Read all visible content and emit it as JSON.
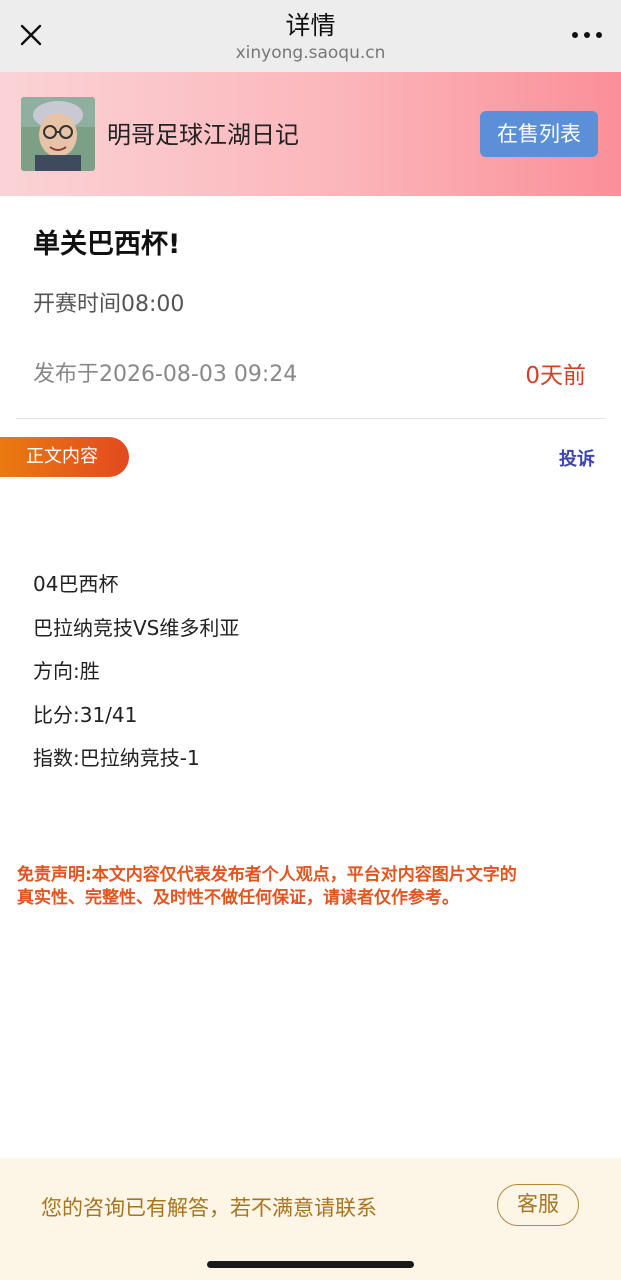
{
  "nav": {
    "title": "详情",
    "url": "xinyong.saoqu.cn"
  },
  "author": {
    "name": "明哥足球江湖日记",
    "sale_button": "在售列表"
  },
  "article": {
    "title": "单关巴西杯!",
    "match_time": "开赛时间08:00",
    "published": "发布于2026-08-03 09:24",
    "days_ago": "0天前"
  },
  "section": {
    "label": "正文内容",
    "report": "投诉"
  },
  "content": {
    "lines": [
      "04巴西杯",
      "巴拉纳竞技VS维多利亚",
      "方向:胜",
      "比分:31/41",
      "指数:巴拉纳竞技-1"
    ]
  },
  "disclaimer": {
    "line1": "免责声明:本文内容仅代表发布者个人观点，平台对内容图片文字的",
    "line2": "真实性、完整性、及时性不做任何保证，请读者仅作参考。"
  },
  "footer": {
    "text": "您的咨询已有解答，若不满意请联系",
    "service_button": "客服"
  },
  "colors": {
    "accent_red": "#d3402a",
    "sale_button_blue": "#5b8fd7",
    "tag_orange": "#ea7a10",
    "disclaimer_orange": "#e3541e",
    "report_blue": "#3d43b5",
    "footer_brown": "#a8741e"
  },
  "icons": {
    "close": "close-icon",
    "more": "more-dots-icon"
  }
}
